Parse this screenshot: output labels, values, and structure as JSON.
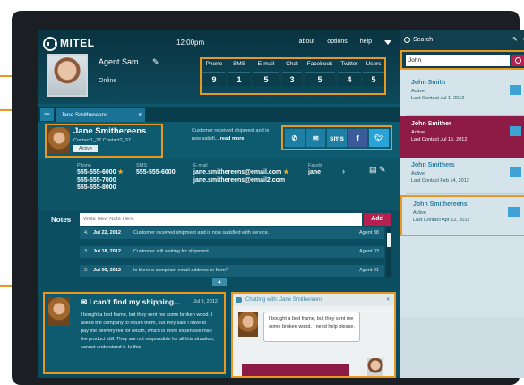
{
  "brand": {
    "logo_text": "MITEL"
  },
  "topbar": {
    "time": "12:00pm",
    "nav": [
      "about",
      "options",
      "help"
    ],
    "agent_name": "Agent Sam",
    "agent_status": "Online"
  },
  "stats": [
    {
      "label": "Phone",
      "value": "9"
    },
    {
      "label": "SMS",
      "value": "1"
    },
    {
      "label": "E-mail",
      "value": "5"
    },
    {
      "label": "Chat",
      "value": "3"
    },
    {
      "label": "Facebook",
      "value": "5"
    },
    {
      "label": "Twitter",
      "value": "4"
    },
    {
      "label": "Users",
      "value": "5"
    }
  ],
  "tab": {
    "add_label": "+",
    "label": "Jane Smithereens",
    "close": "x"
  },
  "contact": {
    "name": "Jane Smithereens",
    "ids": "Contact1_37  Contact2_37",
    "status": "Active",
    "note_text": "Customer received shipment and is now satisfi...",
    "note_link": "read more",
    "channels": [
      "sms",
      "f"
    ]
  },
  "details": {
    "phone_label": "Phone",
    "phones": [
      "555-555-6000",
      "555-555-7000",
      "555-555-8000"
    ],
    "sms_label": "SMS",
    "sms": "555-555-6000",
    "email_label": "E-mail",
    "emails": [
      "jane.smithereens@email.com",
      "jane.smithereens@email2.com"
    ],
    "fb_label": "Faceb",
    "fb": "jane"
  },
  "notes": {
    "label": "Notes",
    "placeholder": "Write New Note Here",
    "add_label": "Add",
    "rows": [
      {
        "n": "4.",
        "date": "Jul 22, 2012",
        "text": "Customer received shipment and is now satisfied with service.",
        "agent": "Agent 38"
      },
      {
        "n": "3.",
        "date": "Jul 18, 2012",
        "text": "Customer still waiting for shipment",
        "agent": "Agent 03"
      },
      {
        "n": "2.",
        "date": "Jul 09, 2012",
        "text": "Is there a compliant email address or form?",
        "agent": "Agent 01"
      }
    ]
  },
  "email": {
    "subject": "I can't find my shipping...",
    "date": "Jul 9, 2012",
    "body": "I bought a bed frame, but they sent me some broken wood. I asked the company to return them, but they said I have to pay the delivery fee for return, which is more expensive than the product still. They are not responsible for all this situation, cannot understand it. Is this"
  },
  "chat": {
    "title": "Chatting with: Jane Smithereens",
    "message": "I bought a bed frame, but they sent me some broken wood. I need help please."
  },
  "search": {
    "title": "Search",
    "query": "John",
    "results": [
      {
        "name": "John Smith",
        "status": "Active",
        "last": "Last Contact Jul 1, 2012"
      },
      {
        "name": "John Smither",
        "status": "Active",
        "last": "Last Contact Jul 15, 2012"
      },
      {
        "name": "John Smithers",
        "status": "Active",
        "last": "Last Contact Feb 14, 2012"
      },
      {
        "name": "John Smithereens",
        "status": "Active",
        "last": "Last Contact Apr 12, 2012"
      }
    ]
  },
  "colors": {
    "accent": "#e8981f",
    "brand_teal": "#0f5b70",
    "alert_red": "#b52050",
    "selected": "#8d1b45"
  }
}
